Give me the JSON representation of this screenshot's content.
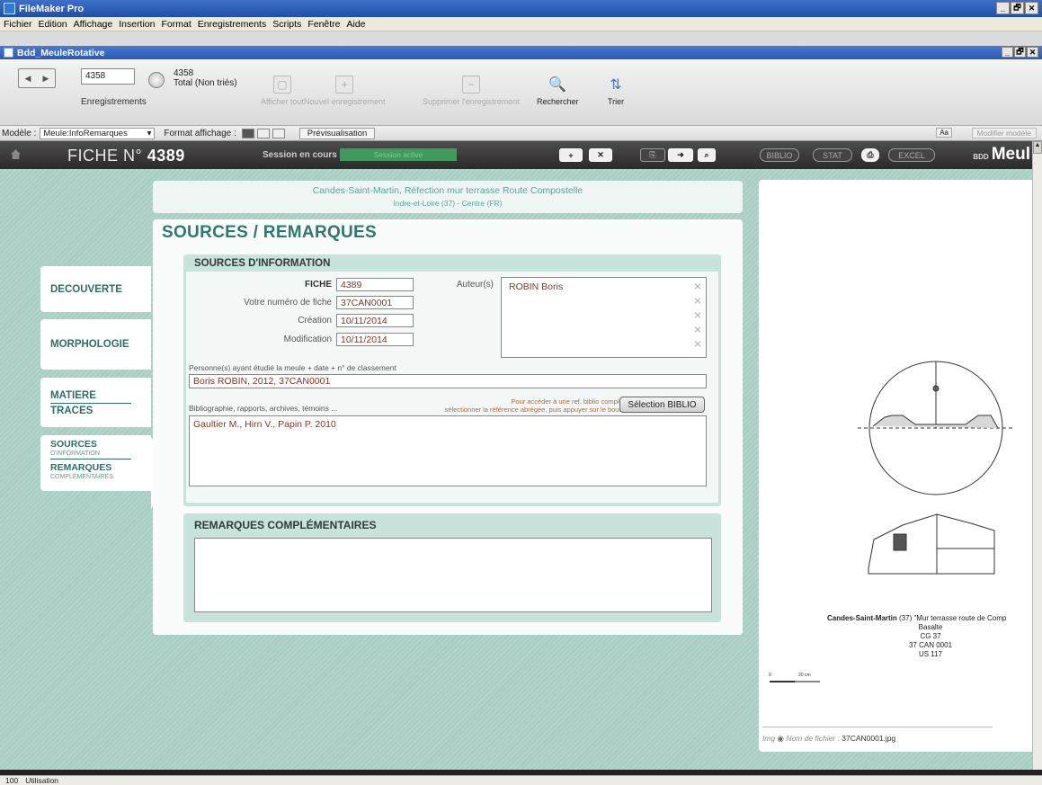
{
  "window": {
    "app_title": "FileMaker Pro",
    "doc_title": "Bdd_MeuleRotative",
    "title_controls": [
      "_",
      "🗗",
      "✕"
    ]
  },
  "menu": [
    "Fichier",
    "Edition",
    "Affichage",
    "Insertion",
    "Format",
    "Enregistrements",
    "Scripts",
    "Fenêtre",
    "Aide"
  ],
  "toolbar": {
    "record_value": "4358",
    "records_label": "Enregistrements",
    "count": "4358",
    "total_label": "Total (Non triés)",
    "show_all": "Afficher tout",
    "new_record": "Nouvel enregistrement",
    "delete_record": "Supprimer l'enregistrement",
    "search": "Rechercher",
    "sort": "Trier"
  },
  "layoutbar": {
    "layout_label": "Modèle :",
    "layout_value": "Meule:InfoRemarques",
    "format_label": "Format affichage :",
    "preview": "Prévisualisation",
    "aa": "Aa",
    "modify_layout": "Modifier modèle"
  },
  "header": {
    "fiche_prefix": "FICHE N°",
    "fiche_number": "4389",
    "session_label": "Session en cours :",
    "session_value": "Session active",
    "btn_new": "+",
    "btn_delete": "✕",
    "btn_copy": "⎘",
    "btn_arrow": "➜",
    "btn_search": "⌕",
    "btn_biblio": "BIBLIO",
    "btn_stat": "STAT",
    "btn_print": "⎙",
    "btn_excel": "EXCEL",
    "brand_prefix": "BDD",
    "brand": "Meul"
  },
  "location": {
    "line1": "Candes-Saint-Martin, Réfection mur terrasse Route Compostelle",
    "line2": "Indre-et-Loire (37) - Centre (FR)"
  },
  "tabs": {
    "decouverte": "DECOUVERTE",
    "morphologie": "MORPHOLOGIE",
    "matiere": "MATIERE",
    "traces": "TRACES",
    "sources": "SOURCES",
    "sources_sub": "D'INFORMATION",
    "remarques": "REMARQUES",
    "remarques_sub": "COMPLÉMENTAIRES"
  },
  "page": {
    "title": "SOURCES / REMARQUES",
    "sources_title": "SOURCES D'INFORMATION",
    "remarks_title": "REMARQUES COMPLÉMENTAIRES"
  },
  "form": {
    "fiche_label": "FICHE",
    "fiche_value": "4389",
    "votre_label": "Votre numéro de fiche",
    "votre_value": "37CAN0001",
    "creation_label": "Création",
    "creation_value": "10/11/2014",
    "modification_label": "Modification",
    "modification_value": "10/11/2014",
    "auteurs_label": "Auteur(s)",
    "auteur_value": "ROBIN Boris",
    "personnes_label": "Personne(s) ayant étudié la meule + date + n° de classement",
    "personnes_value": "Boris ROBIN, 2012, 37CAN0001",
    "biblio_label": "Bibliographie, rapports, archives, témoins ...",
    "hint_line1": "Pour accéder à une ref. biblio complète,",
    "hint_line2": "sélectionner la référence abrégée, puis appuyer sur le bouton.",
    "selection_button": "Sélection BIBLIO",
    "biblio_value": "Gaultier M., Hirn V., Papin P. 2010",
    "remarks_value": ""
  },
  "drawing": {
    "caption_place": "Candes-Saint-Martin",
    "caption_rest": " (37) \"Mur terrasse route de Comp",
    "caption_lines": [
      "Basalte",
      "CG 37",
      "37 CAN 0001",
      "US 117"
    ],
    "scale_zero": "0",
    "scale_max": "20 cm",
    "file_prefix": "Img",
    "file_label": "Nom de fichier :",
    "file_name": "37CAN0001.jpg"
  },
  "statusline": {
    "zoom": "100",
    "mode": "Utilisation"
  }
}
